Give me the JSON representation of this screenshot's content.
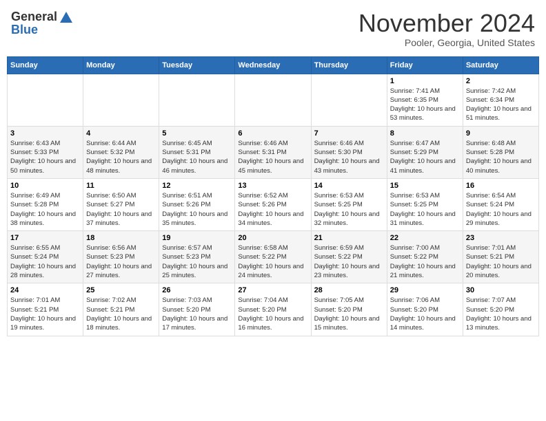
{
  "header": {
    "logo_general": "General",
    "logo_blue": "Blue",
    "month_title": "November 2024",
    "subtitle": "Pooler, Georgia, United States"
  },
  "calendar": {
    "days_of_week": [
      "Sunday",
      "Monday",
      "Tuesday",
      "Wednesday",
      "Thursday",
      "Friday",
      "Saturday"
    ],
    "weeks": [
      [
        {
          "day": "",
          "info": ""
        },
        {
          "day": "",
          "info": ""
        },
        {
          "day": "",
          "info": ""
        },
        {
          "day": "",
          "info": ""
        },
        {
          "day": "",
          "info": ""
        },
        {
          "day": "1",
          "info": "Sunrise: 7:41 AM\nSunset: 6:35 PM\nDaylight: 10 hours and 53 minutes."
        },
        {
          "day": "2",
          "info": "Sunrise: 7:42 AM\nSunset: 6:34 PM\nDaylight: 10 hours and 51 minutes."
        }
      ],
      [
        {
          "day": "3",
          "info": "Sunrise: 6:43 AM\nSunset: 5:33 PM\nDaylight: 10 hours and 50 minutes."
        },
        {
          "day": "4",
          "info": "Sunrise: 6:44 AM\nSunset: 5:32 PM\nDaylight: 10 hours and 48 minutes."
        },
        {
          "day": "5",
          "info": "Sunrise: 6:45 AM\nSunset: 5:31 PM\nDaylight: 10 hours and 46 minutes."
        },
        {
          "day": "6",
          "info": "Sunrise: 6:46 AM\nSunset: 5:31 PM\nDaylight: 10 hours and 45 minutes."
        },
        {
          "day": "7",
          "info": "Sunrise: 6:46 AM\nSunset: 5:30 PM\nDaylight: 10 hours and 43 minutes."
        },
        {
          "day": "8",
          "info": "Sunrise: 6:47 AM\nSunset: 5:29 PM\nDaylight: 10 hours and 41 minutes."
        },
        {
          "day": "9",
          "info": "Sunrise: 6:48 AM\nSunset: 5:28 PM\nDaylight: 10 hours and 40 minutes."
        }
      ],
      [
        {
          "day": "10",
          "info": "Sunrise: 6:49 AM\nSunset: 5:28 PM\nDaylight: 10 hours and 38 minutes."
        },
        {
          "day": "11",
          "info": "Sunrise: 6:50 AM\nSunset: 5:27 PM\nDaylight: 10 hours and 37 minutes."
        },
        {
          "day": "12",
          "info": "Sunrise: 6:51 AM\nSunset: 5:26 PM\nDaylight: 10 hours and 35 minutes."
        },
        {
          "day": "13",
          "info": "Sunrise: 6:52 AM\nSunset: 5:26 PM\nDaylight: 10 hours and 34 minutes."
        },
        {
          "day": "14",
          "info": "Sunrise: 6:53 AM\nSunset: 5:25 PM\nDaylight: 10 hours and 32 minutes."
        },
        {
          "day": "15",
          "info": "Sunrise: 6:53 AM\nSunset: 5:25 PM\nDaylight: 10 hours and 31 minutes."
        },
        {
          "day": "16",
          "info": "Sunrise: 6:54 AM\nSunset: 5:24 PM\nDaylight: 10 hours and 29 minutes."
        }
      ],
      [
        {
          "day": "17",
          "info": "Sunrise: 6:55 AM\nSunset: 5:24 PM\nDaylight: 10 hours and 28 minutes."
        },
        {
          "day": "18",
          "info": "Sunrise: 6:56 AM\nSunset: 5:23 PM\nDaylight: 10 hours and 27 minutes."
        },
        {
          "day": "19",
          "info": "Sunrise: 6:57 AM\nSunset: 5:23 PM\nDaylight: 10 hours and 25 minutes."
        },
        {
          "day": "20",
          "info": "Sunrise: 6:58 AM\nSunset: 5:22 PM\nDaylight: 10 hours and 24 minutes."
        },
        {
          "day": "21",
          "info": "Sunrise: 6:59 AM\nSunset: 5:22 PM\nDaylight: 10 hours and 23 minutes."
        },
        {
          "day": "22",
          "info": "Sunrise: 7:00 AM\nSunset: 5:22 PM\nDaylight: 10 hours and 21 minutes."
        },
        {
          "day": "23",
          "info": "Sunrise: 7:01 AM\nSunset: 5:21 PM\nDaylight: 10 hours and 20 minutes."
        }
      ],
      [
        {
          "day": "24",
          "info": "Sunrise: 7:01 AM\nSunset: 5:21 PM\nDaylight: 10 hours and 19 minutes."
        },
        {
          "day": "25",
          "info": "Sunrise: 7:02 AM\nSunset: 5:21 PM\nDaylight: 10 hours and 18 minutes."
        },
        {
          "day": "26",
          "info": "Sunrise: 7:03 AM\nSunset: 5:20 PM\nDaylight: 10 hours and 17 minutes."
        },
        {
          "day": "27",
          "info": "Sunrise: 7:04 AM\nSunset: 5:20 PM\nDaylight: 10 hours and 16 minutes."
        },
        {
          "day": "28",
          "info": "Sunrise: 7:05 AM\nSunset: 5:20 PM\nDaylight: 10 hours and 15 minutes."
        },
        {
          "day": "29",
          "info": "Sunrise: 7:06 AM\nSunset: 5:20 PM\nDaylight: 10 hours and 14 minutes."
        },
        {
          "day": "30",
          "info": "Sunrise: 7:07 AM\nSunset: 5:20 PM\nDaylight: 10 hours and 13 minutes."
        }
      ]
    ]
  }
}
